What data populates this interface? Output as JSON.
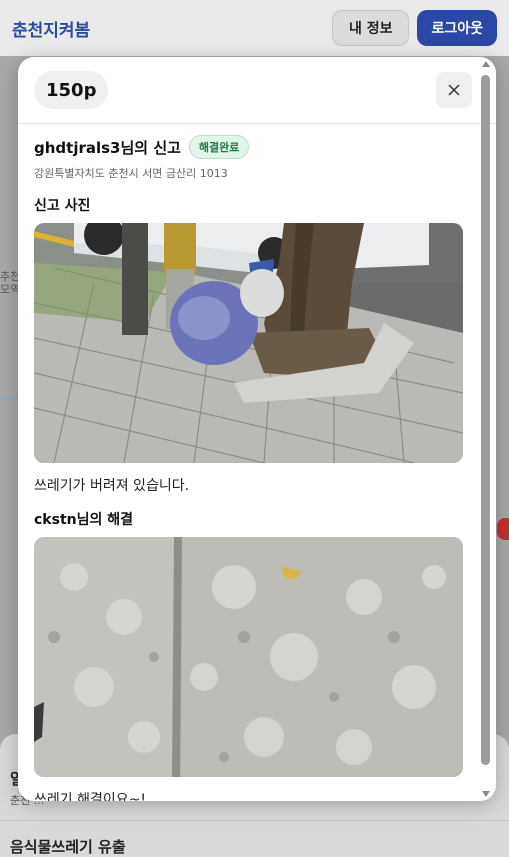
{
  "app": {
    "brand": "춘천지켜봄",
    "my_info_label": "내 정보",
    "logout_label": "로그아웃"
  },
  "map": {
    "label_lines": [
      "추천",
      "모역"
    ]
  },
  "background_list": {
    "item_a_title": "일",
    "item_a_sub": "춘천 ...",
    "item_b_title": "음식물쓰레기 유출"
  },
  "modal": {
    "points": "150p",
    "report_title": "ghdtjrals3님의 신고",
    "status_badge": "해결완료",
    "address": "강원특별자치도 춘천시 서면 금산리 1013",
    "report_photo_heading": "신고 사진",
    "report_description": "쓰레기가 버려져 있습니다.",
    "resolution_heading": "ckstn님의 해결",
    "resolution_description": "쓰레기 해결이요~!"
  },
  "colors": {
    "brand": "#2e4a9e",
    "logout_bg": "#2a48a5",
    "badge_bg": "#e2f5ea",
    "badge_text": "#1e7a47"
  },
  "icons": {
    "close": "close-icon"
  }
}
